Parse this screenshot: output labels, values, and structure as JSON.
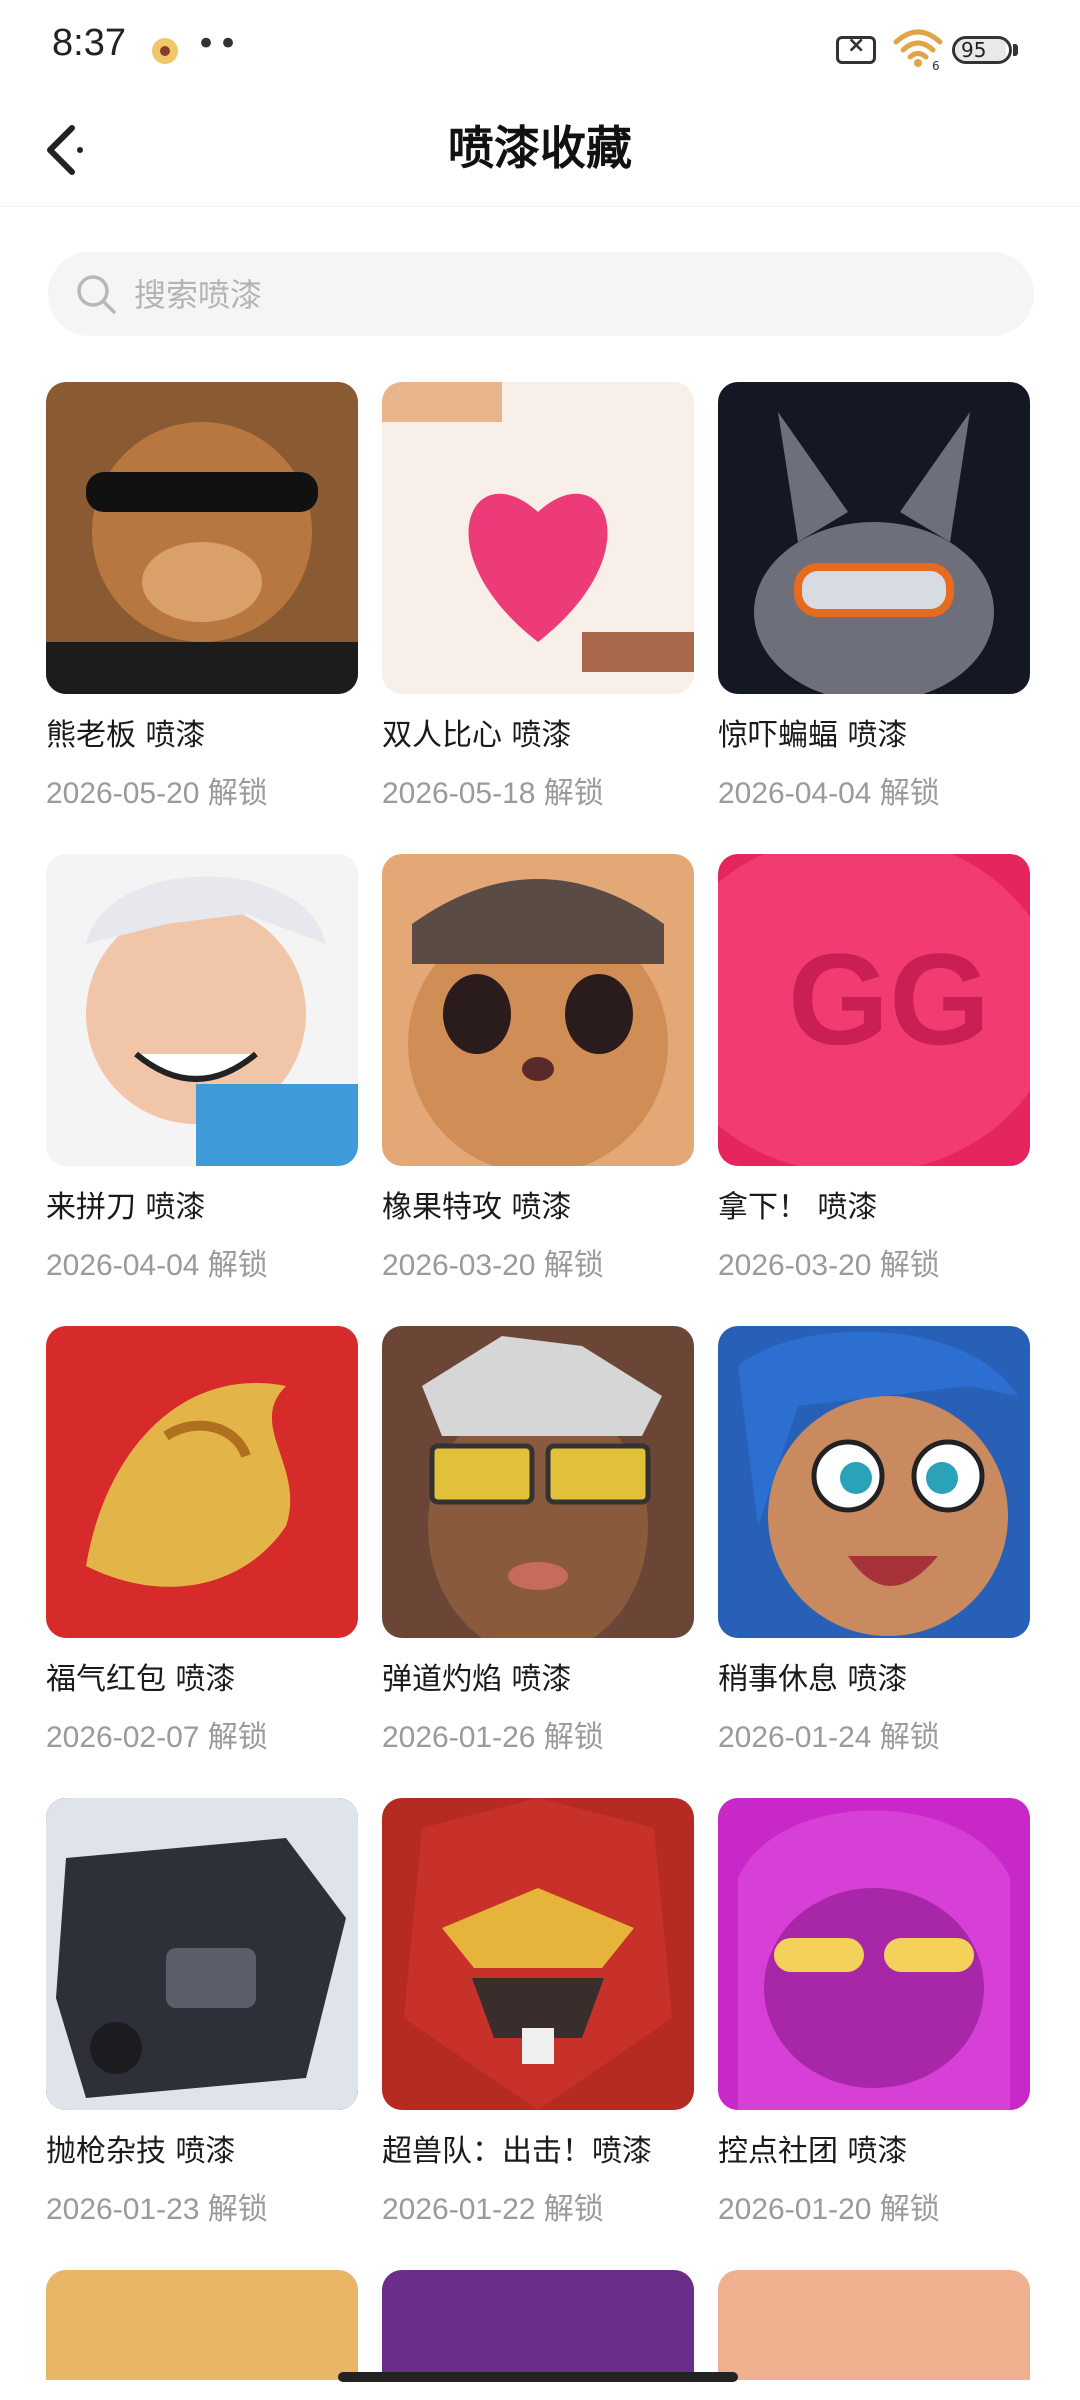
{
  "status_bar": {
    "time": "8:37",
    "dots": "••",
    "sim_icon": "sim-card-x-icon",
    "signal_label": "6",
    "battery_level": 95,
    "battery_text": "95"
  },
  "header": {
    "title": "喷漆收藏",
    "back_icon": "chevron-left-icon"
  },
  "search": {
    "placeholder": "搜索喷漆",
    "value": ""
  },
  "sprays": [
    {
      "name": "熊老板 喷漆",
      "date": "2026-05-20 解锁",
      "bg": "#8a5a32"
    },
    {
      "name": "双人比心 喷漆",
      "date": "2026-05-18 解锁",
      "bg": "#f7efe8"
    },
    {
      "name": "惊吓蝙蝠 喷漆",
      "date": "2026-04-04 解锁",
      "bg": "#141824"
    },
    {
      "name": "来拼刀 喷漆",
      "date": "2026-04-04 解锁",
      "bg": "#f4f4f4"
    },
    {
      "name": "橡果特攻 喷漆",
      "date": "2026-03-20 解锁",
      "bg": "#e4a877"
    },
    {
      "name": "拿下！ 喷漆",
      "date": "2026-03-20 解锁",
      "bg": "#e5265e"
    },
    {
      "name": "福气红包 喷漆",
      "date": "2026-02-07 解锁",
      "bg": "#d72a2a"
    },
    {
      "name": "弹道灼焰 喷漆",
      "date": "2026-01-26 解锁",
      "bg": "#6b4636"
    },
    {
      "name": "稍事休息 喷漆",
      "date": "2026-01-24 解锁",
      "bg": "#2860b8"
    },
    {
      "name": "抛枪杂技 喷漆",
      "date": "2026-01-23 解锁",
      "bg": "#23252b"
    },
    {
      "name": "超兽队：出击！喷漆",
      "date": "2026-01-22 解锁",
      "bg": "#b52b23"
    },
    {
      "name": "控点社团 喷漆",
      "date": "2026-01-20 解锁",
      "bg": "#c928c9"
    }
  ],
  "partial_row_bgs": [
    "#e9b566",
    "#6b2c8a",
    "#efb08f"
  ],
  "colors": {
    "accent_text": "#1a1a1a",
    "date_text": "#9a9a9a"
  }
}
